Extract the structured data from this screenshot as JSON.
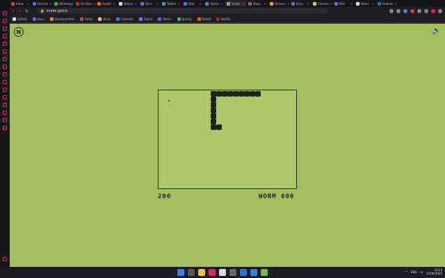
{
  "browser": {
    "url": "snake.game",
    "tabs": [
      {
        "label": "Inbox",
        "color": "#d63c3c",
        "active": false
      },
      {
        "label": "Discord",
        "color": "#5865f2",
        "active": false
      },
      {
        "label": "WhatsApp",
        "color": "#2bb741",
        "active": false
      },
      {
        "label": "YouTube",
        "color": "#e02020",
        "active": false
      },
      {
        "label": "Reddit",
        "color": "#ff5700",
        "active": false
      },
      {
        "label": "Notion",
        "color": "#dddddd",
        "active": false
      },
      {
        "label": "Docs",
        "color": "#3d7cf0",
        "active": false
      },
      {
        "label": "Twitter",
        "color": "#1d9bf0",
        "active": false
      },
      {
        "label": "Mail",
        "color": "#3d7cf0",
        "active": false
      },
      {
        "label": "Twitter",
        "color": "#1d9bf0",
        "active": false
      },
      {
        "label": "Snake",
        "color": "#7ab84a",
        "active": true
      },
      {
        "label": "Maps",
        "color": "#e94335",
        "active": false
      },
      {
        "label": "Amazon",
        "color": "#ff9900",
        "active": false
      },
      {
        "label": "Docs",
        "color": "#3d7cf0",
        "active": false
      },
      {
        "label": "Chrome",
        "color": "#f1c232",
        "active": false
      },
      {
        "label": "Mail",
        "color": "#3d7cf0",
        "active": false
      },
      {
        "label": "Notes",
        "color": "#dddddd",
        "active": false
      },
      {
        "label": "Outlook",
        "color": "#0078d4",
        "active": false
      }
    ],
    "bookmarks": [
      {
        "label": "GitHub",
        "color": "#dddddd"
      },
      {
        "label": "Docs",
        "color": "#3d7cf0"
      },
      {
        "label": "Stackoverflow",
        "color": "#f48024"
      },
      {
        "label": "Gmail",
        "color": "#d63c3c"
      },
      {
        "label": "Drive",
        "color": "#f1c232"
      },
      {
        "label": "Calendar",
        "color": "#3d7cf0"
      },
      {
        "label": "Figma",
        "color": "#a259ff"
      },
      {
        "label": "Twitch",
        "color": "#9146ff"
      },
      {
        "label": "Spotify",
        "color": "#1db954"
      },
      {
        "label": "Reddit",
        "color": "#ff5700"
      },
      {
        "label": "Netflix",
        "color": "#e50914"
      }
    ]
  },
  "game": {
    "score": "200",
    "player": "WORM 600",
    "logo_letter": "N",
    "snake_cells": [
      [
        0,
        0
      ],
      [
        1,
        0
      ],
      [
        2,
        0
      ],
      [
        3,
        0
      ],
      [
        4,
        0
      ],
      [
        5,
        0
      ],
      [
        6,
        0
      ],
      [
        7,
        0
      ],
      [
        8,
        0
      ],
      [
        0,
        1
      ],
      [
        0,
        2
      ],
      [
        0,
        3
      ],
      [
        0,
        4
      ],
      [
        0,
        5
      ],
      [
        0,
        6
      ]
    ],
    "food_cell": [
      1,
      1
    ]
  },
  "system": {
    "time": "10:24",
    "date": "12/06/2025",
    "tray_label": "ENG"
  },
  "colors": {
    "background": "#a2be5e",
    "board": "#abc96a",
    "snake": "#1b2316",
    "accent_sidebar": "#e0245e"
  }
}
